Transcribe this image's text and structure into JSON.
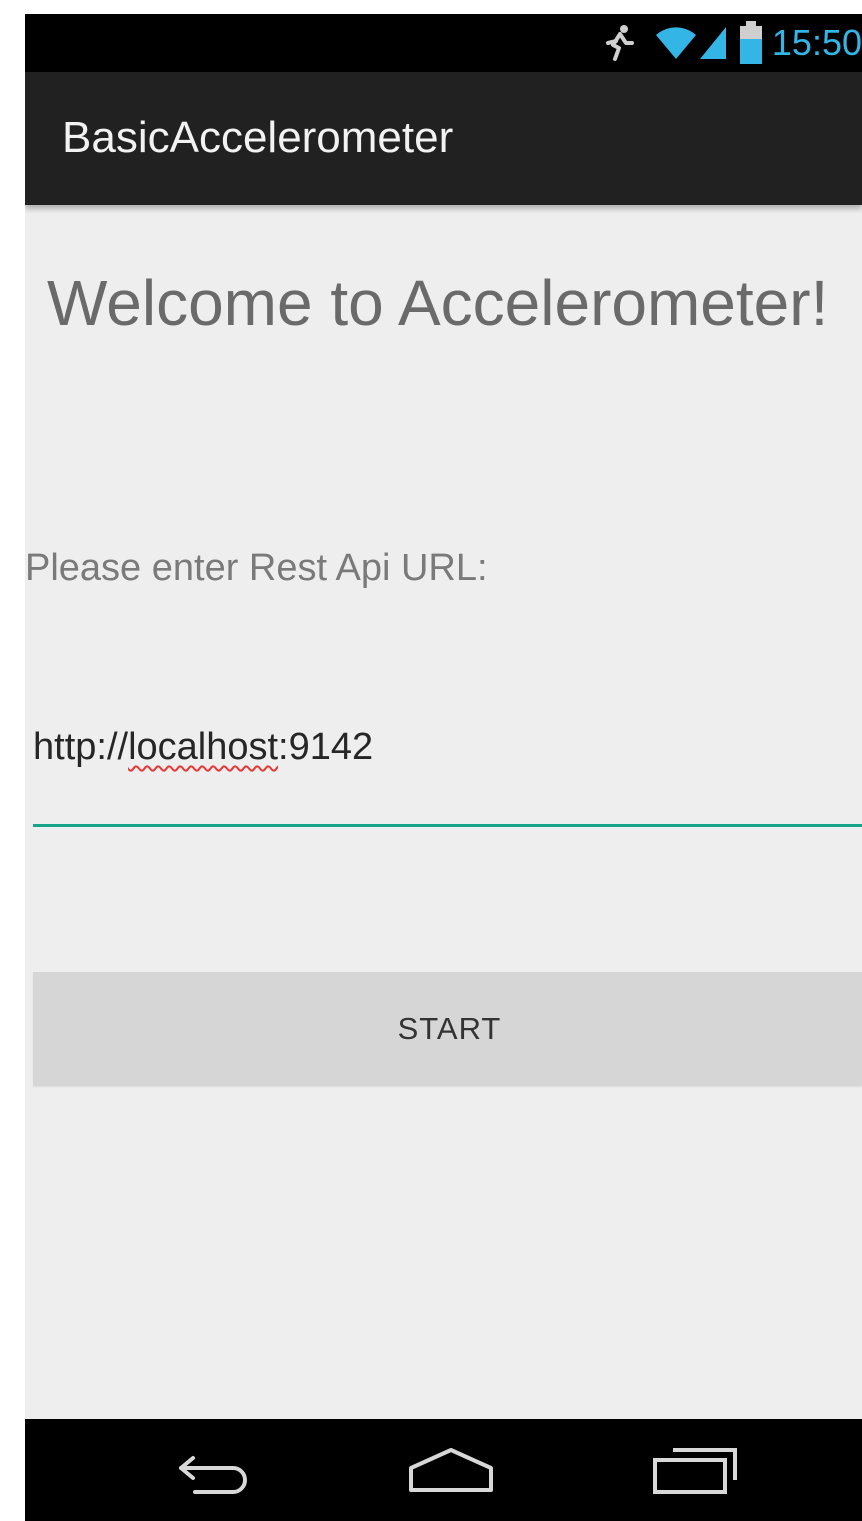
{
  "status_bar": {
    "time": "15:50",
    "icons": [
      "run-icon",
      "wifi-icon",
      "signal-icon",
      "battery-icon"
    ],
    "time_color": "#33b5e5"
  },
  "action_bar": {
    "title": "BasicAccelerometer"
  },
  "content": {
    "welcome": "Welcome to Accelerometer!",
    "prompt": "Please enter Rest Api URL:",
    "url_input": {
      "prefix": "http://",
      "misspelled": "localhost",
      "suffix": ":9142"
    },
    "start_button": "START",
    "accent_color": "#17a589"
  },
  "nav_bar": {
    "icons": [
      "back-icon",
      "home-icon",
      "recents-icon"
    ]
  }
}
